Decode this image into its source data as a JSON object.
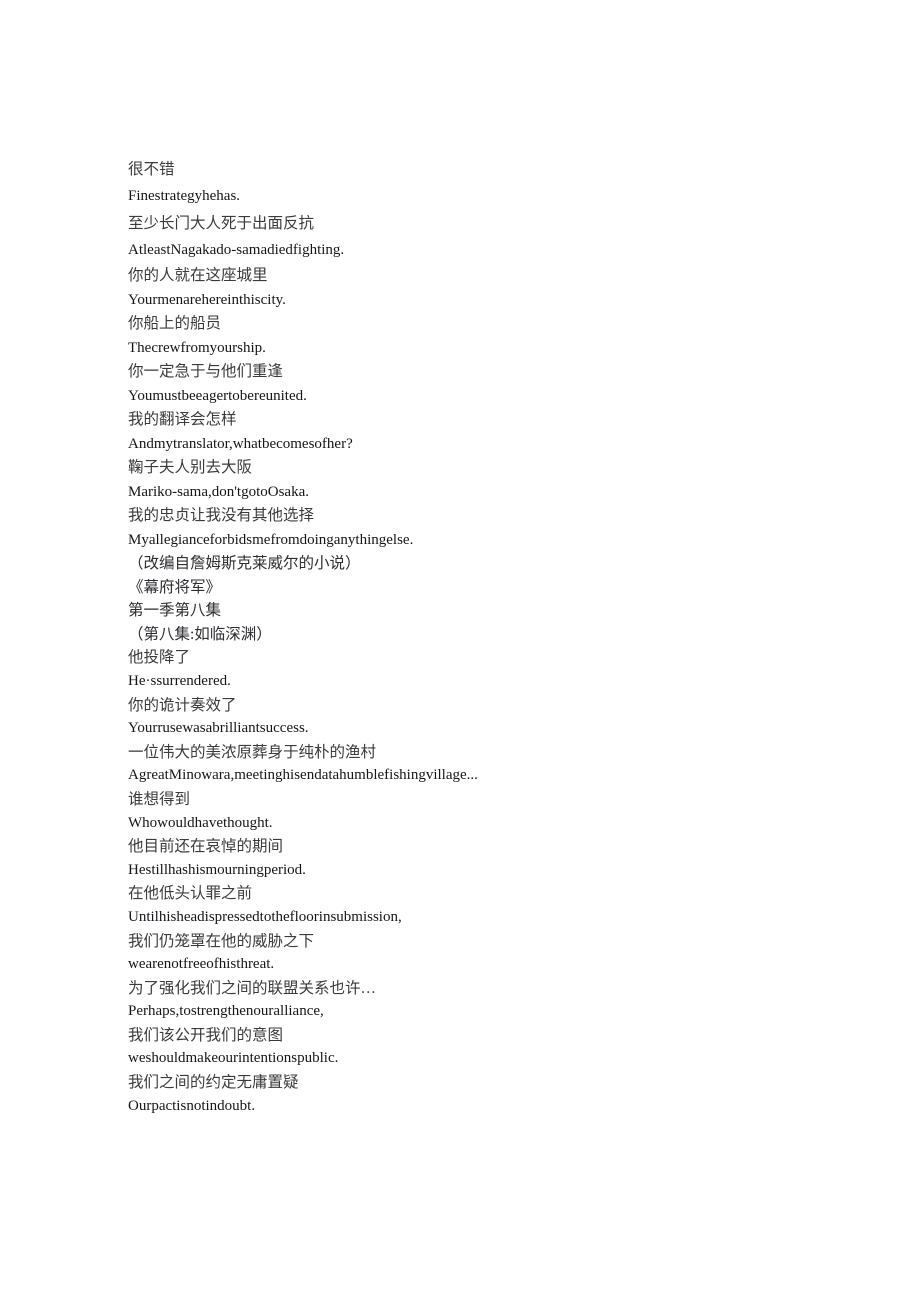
{
  "document": {
    "type": "subtitle-transcript",
    "language_primary": "zh-CN",
    "language_secondary": "en",
    "background_color": "#ffffff",
    "text_color_chinese": "#3b3b3b",
    "text_color_english": "#16161a",
    "lines": [
      {
        "id": "l1",
        "lang": "zh",
        "spacing": "loose",
        "text": "很不错"
      },
      {
        "id": "l2",
        "lang": "en",
        "spacing": "loose",
        "text": "Finestrategyhehas."
      },
      {
        "id": "l3",
        "lang": "zh",
        "spacing": "loose",
        "text": "至少长门大人死于出面反抗"
      },
      {
        "id": "l4",
        "lang": "en",
        "spacing": "loose",
        "text": "AtleastNagakado-samadiedfighting."
      },
      {
        "id": "l5",
        "lang": "zh",
        "spacing": "normal",
        "text": "你的人就在这座城里"
      },
      {
        "id": "l6",
        "lang": "en",
        "spacing": "normal",
        "text": "Yourmenarehereinthiscity."
      },
      {
        "id": "l7",
        "lang": "zh",
        "spacing": "normal",
        "text": "你船上的船员"
      },
      {
        "id": "l8",
        "lang": "en",
        "spacing": "normal",
        "text": "Thecrewfromyourship."
      },
      {
        "id": "l9",
        "lang": "zh",
        "spacing": "normal",
        "text": "你一定急于与他们重逢"
      },
      {
        "id": "l10",
        "lang": "en",
        "spacing": "normal",
        "text": "Youmustbeeagertobereunited."
      },
      {
        "id": "l11",
        "lang": "zh",
        "spacing": "normal",
        "text": "我的翻译会怎样"
      },
      {
        "id": "l12",
        "lang": "en",
        "spacing": "normal",
        "text": "Andmytranslator,whatbecomesofher?"
      },
      {
        "id": "l13",
        "lang": "zh",
        "spacing": "normal",
        "text": "鞠子夫人别去大阪"
      },
      {
        "id": "l14",
        "lang": "en",
        "spacing": "normal",
        "text": "Mariko-sama,don'tgotoOsaka."
      },
      {
        "id": "l15",
        "lang": "zh",
        "spacing": "normal",
        "text": "我的忠贞让我没有其他选择"
      },
      {
        "id": "l16",
        "lang": "en",
        "spacing": "normal",
        "text": "Myallegianceforbidsmefromdoinganythingelse."
      },
      {
        "id": "l17",
        "lang": "meta",
        "spacing": "tight",
        "text": "（改编自詹姆斯克莱威尔的小说）"
      },
      {
        "id": "l18",
        "lang": "meta",
        "spacing": "tight",
        "text": "《幕府将军》"
      },
      {
        "id": "l19",
        "lang": "meta",
        "spacing": "tight",
        "text": "第一季第八集"
      },
      {
        "id": "l20",
        "lang": "meta",
        "spacing": "tight",
        "text": "（第八集:如临深渊）"
      },
      {
        "id": "l21",
        "lang": "zh",
        "spacing": "tight",
        "text": "他投降了"
      },
      {
        "id": "l22",
        "lang": "en",
        "spacing": "tight",
        "text": "He·ssurrendered."
      },
      {
        "id": "l23",
        "lang": "zh",
        "spacing": "tight",
        "text": "你的诡计奏效了"
      },
      {
        "id": "l24",
        "lang": "en",
        "spacing": "tight",
        "text": "Yourrusewasabrilliantsuccess."
      },
      {
        "id": "l25",
        "lang": "zh",
        "spacing": "tight",
        "text": "一位伟大的美浓原葬身于纯朴的渔村"
      },
      {
        "id": "l26",
        "lang": "en",
        "spacing": "tight",
        "text": "AgreatMinowara,meetinghisendatahumblefishingvillage..."
      },
      {
        "id": "l27",
        "lang": "zh",
        "spacing": "tight",
        "text": "谁想得到"
      },
      {
        "id": "l28",
        "lang": "en",
        "spacing": "tight",
        "text": "Whowouldhavethought."
      },
      {
        "id": "l29",
        "lang": "zh",
        "spacing": "tight",
        "text": "他目前还在哀悼的期间"
      },
      {
        "id": "l30",
        "lang": "en",
        "spacing": "tight",
        "text": "Hestillhashismourningperiod."
      },
      {
        "id": "l31",
        "lang": "zh",
        "spacing": "tight",
        "text": "在他低头认罪之前"
      },
      {
        "id": "l32",
        "lang": "en",
        "spacing": "tight",
        "text": "Untilhisheadispressedtothefloorinsubmission,"
      },
      {
        "id": "l33",
        "lang": "zh",
        "spacing": "tight",
        "text": "我们仍笼罩在他的威胁之下"
      },
      {
        "id": "l34",
        "lang": "en",
        "spacing": "tight",
        "text": "wearenotfreeofhisthreat."
      },
      {
        "id": "l35",
        "lang": "zh",
        "spacing": "tight",
        "text": "为了强化我们之间的联盟关系也许…"
      },
      {
        "id": "l36",
        "lang": "en",
        "spacing": "tight",
        "text": "Perhaps,tostrengthenouralliance,"
      },
      {
        "id": "l37",
        "lang": "zh",
        "spacing": "tight",
        "text": "我们该公开我们的意图"
      },
      {
        "id": "l38",
        "lang": "en",
        "spacing": "tight",
        "text": "weshouldmakeourintentionspublic."
      },
      {
        "id": "l39",
        "lang": "zh",
        "spacing": "tight",
        "text": "我们之间的约定无庸置疑"
      },
      {
        "id": "l40",
        "lang": "en",
        "spacing": "tight",
        "text": "Ourpactisnotindoubt."
      }
    ]
  }
}
